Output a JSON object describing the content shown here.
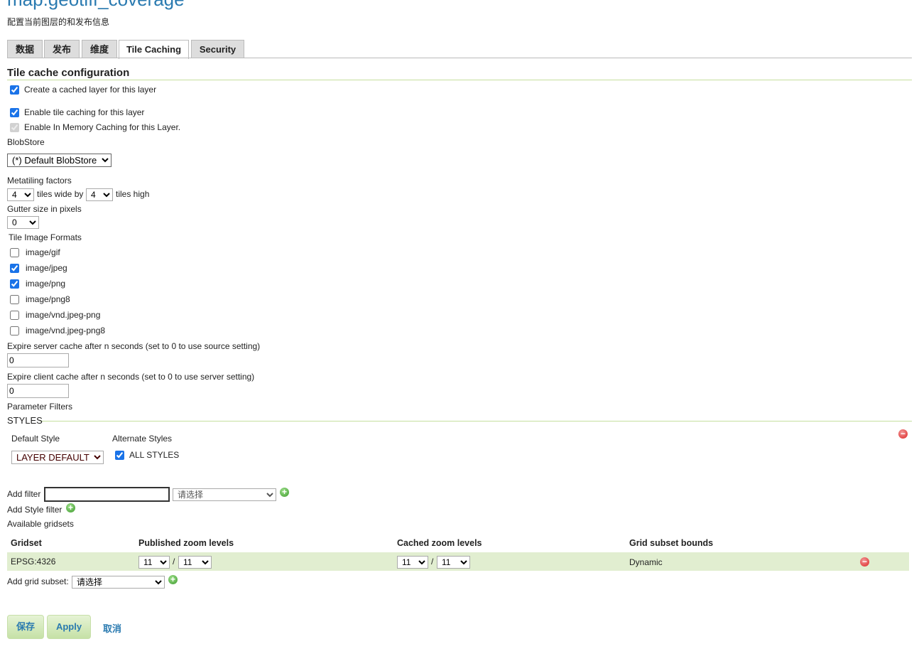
{
  "page": {
    "title": "map:geotiff_coverage",
    "subtitle": "配置当前图层的和发布信息"
  },
  "tabs": [
    {
      "label": "数据"
    },
    {
      "label": "发布"
    },
    {
      "label": "维度"
    },
    {
      "label": "Tile Caching",
      "active": true
    },
    {
      "label": "Security"
    }
  ],
  "section_title": "Tile cache configuration",
  "create_cached": {
    "label": "Create a cached layer for this layer",
    "checked": true
  },
  "enable_tile": {
    "label": "Enable tile caching for this layer",
    "checked": true
  },
  "enable_memory": {
    "label": "Enable In Memory Caching for this Layer.",
    "checked": true,
    "disabled": true
  },
  "blobstore": {
    "label": "BlobStore",
    "value": "(*) Default BlobStore"
  },
  "metatiling": {
    "label": "Metatiling factors",
    "wide": "4",
    "wide_label": "tiles wide by",
    "high": "4",
    "high_label": "tiles high"
  },
  "gutter": {
    "label": "Gutter size in pixels",
    "value": "0"
  },
  "formats": {
    "label": "Tile Image Formats",
    "items": [
      {
        "label": "image/gif",
        "checked": false
      },
      {
        "label": "image/jpeg",
        "checked": true
      },
      {
        "label": "image/png",
        "checked": true
      },
      {
        "label": "image/png8",
        "checked": false
      },
      {
        "label": "image/vnd.jpeg-png",
        "checked": false
      },
      {
        "label": "image/vnd.jpeg-png8",
        "checked": false
      }
    ]
  },
  "expire_server": {
    "label": "Expire server cache after n seconds (set to 0 to use source setting)",
    "value": "0"
  },
  "expire_client": {
    "label": "Expire client cache after n seconds (set to 0 to use server setting)",
    "value": "0"
  },
  "param_filters": "Parameter Filters",
  "styles": {
    "legend": "STYLES",
    "default_label": "Default Style",
    "default_value": "LAYER DEFAULT",
    "alternate_label": "Alternate Styles",
    "all_styles": "ALL STYLES",
    "all_checked": true
  },
  "add_filter": {
    "label": "Add filter",
    "value": "",
    "select": "请选择"
  },
  "add_style_filter": "Add Style filter",
  "gridsets": {
    "label": "Available gridsets",
    "headers": [
      "Gridset",
      "Published zoom levels",
      "Cached zoom levels",
      "Grid subset bounds"
    ],
    "rows": [
      {
        "name": "EPSG:4326",
        "pub_min": "11",
        "pub_max": "11",
        "cache_min": "11",
        "cache_max": "11",
        "bounds": "Dynamic"
      }
    ],
    "sep": "/"
  },
  "add_grid_subset": {
    "label": "Add grid subset:",
    "select": "请选择"
  },
  "buttons": {
    "save": "保存",
    "apply": "Apply",
    "cancel": "取消"
  }
}
